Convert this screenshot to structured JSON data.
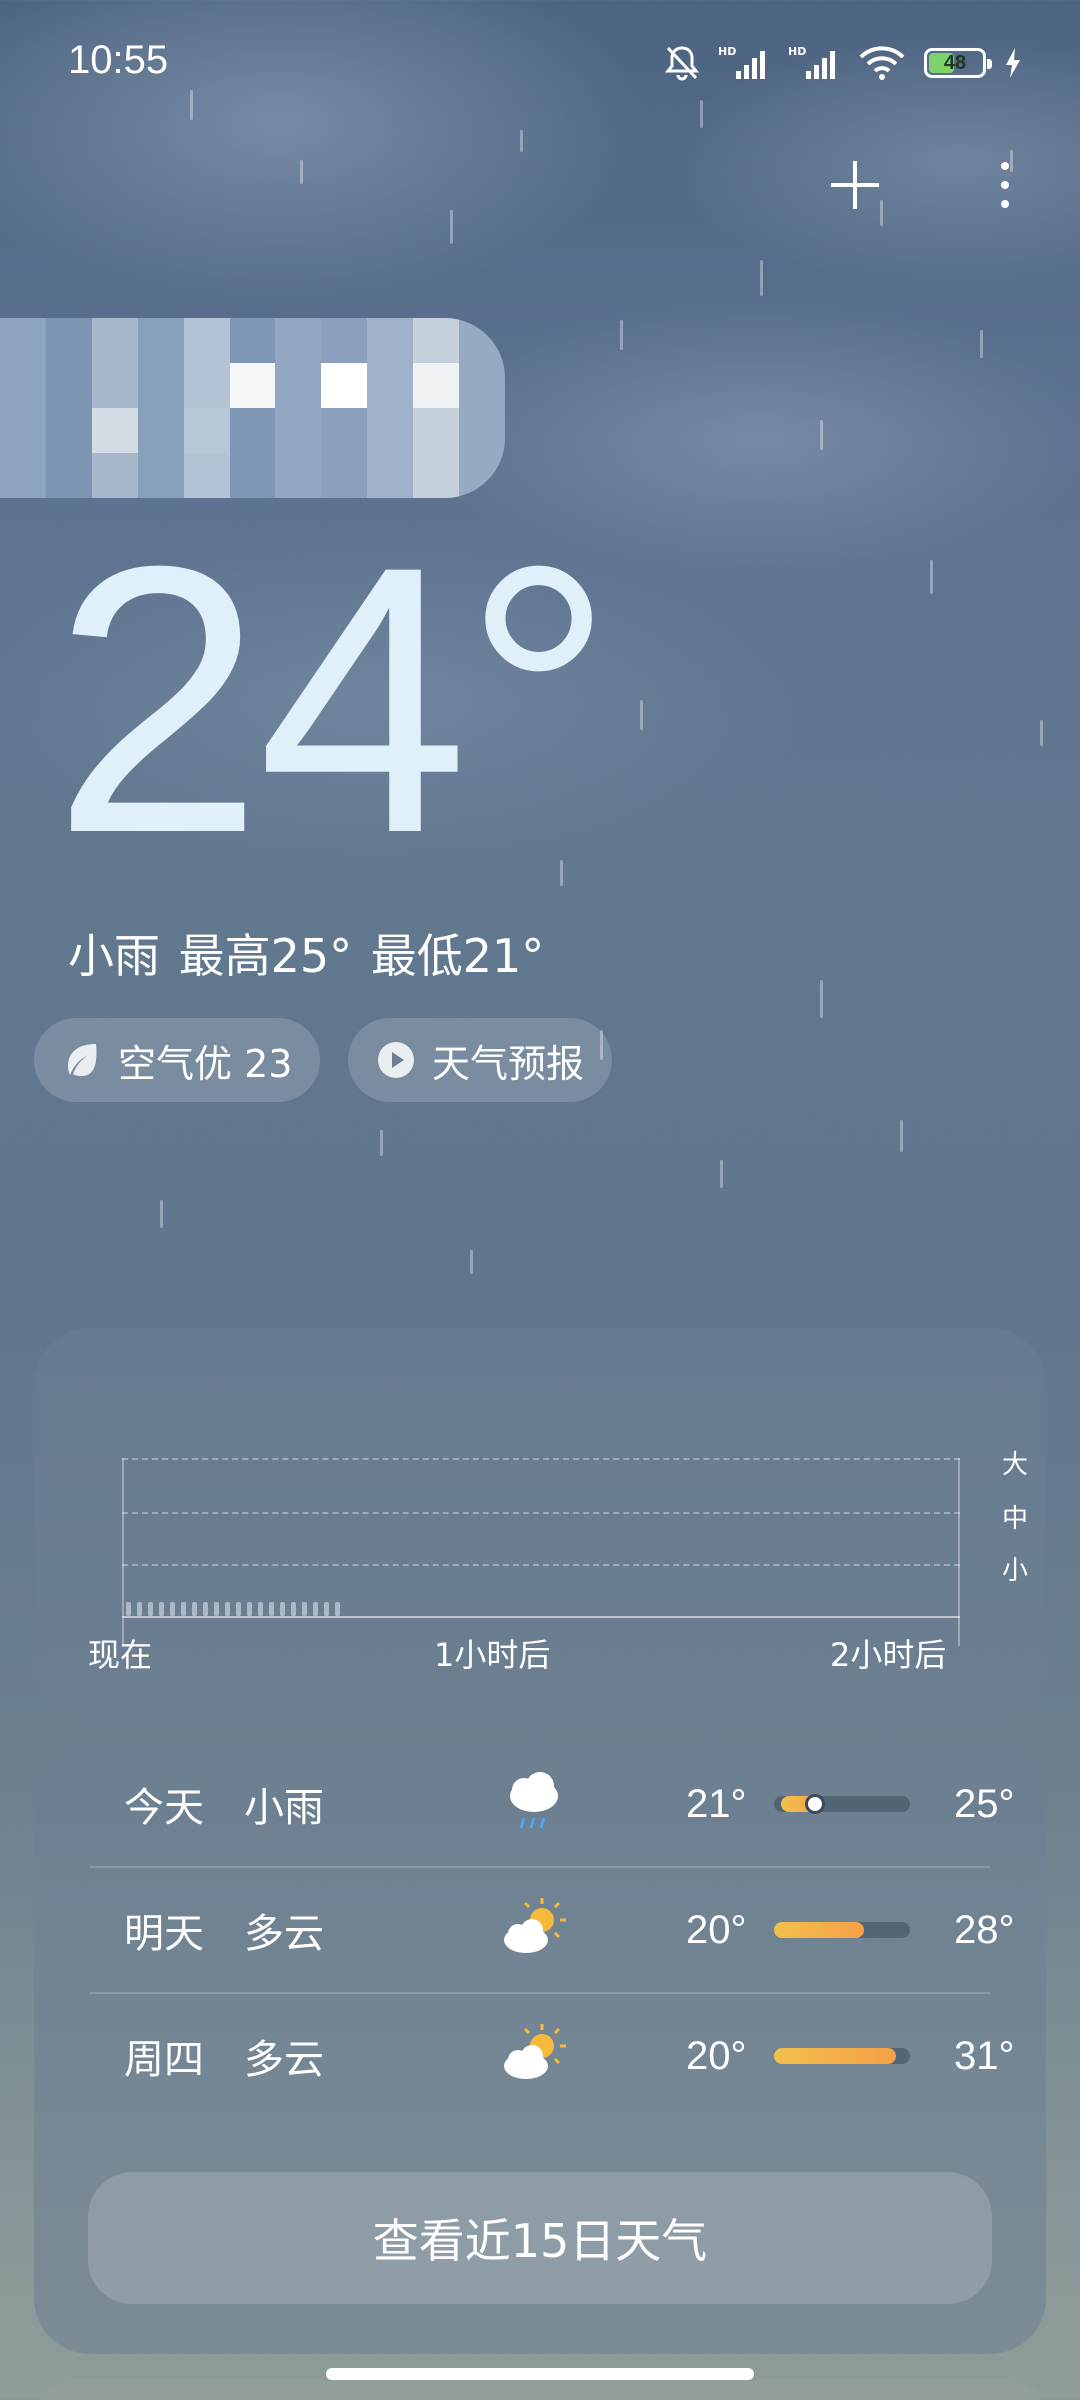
{
  "status_bar": {
    "time": "10:55",
    "battery": "48"
  },
  "current": {
    "temperature": "24°",
    "summary": "小雨  最高25° 最低21°"
  },
  "pills": [
    {
      "label": "空气优 23",
      "icon": "leaf-icon"
    },
    {
      "label": "天气预报",
      "icon": "play-icon"
    }
  ],
  "precipitation": {
    "levels": [
      "大",
      "中",
      "小"
    ],
    "time_labels": [
      "现在",
      "1小时后",
      "2小时后"
    ]
  },
  "forecast": [
    {
      "day": "今天",
      "condition": "小雨",
      "icon": "rain-cloud-icon",
      "low": "21°",
      "high": "25°",
      "range_start": 0.05,
      "range_end": 0.35,
      "current_marker": 0.3
    },
    {
      "day": "明天",
      "condition": "多云",
      "icon": "partly-cloudy-icon",
      "low": "20°",
      "high": "28°",
      "range_start": 0.0,
      "range_end": 0.66
    },
    {
      "day": "周四",
      "condition": "多云",
      "icon": "partly-cloudy-icon",
      "low": "20°",
      "high": "31°",
      "range_start": 0.0,
      "range_end": 0.9
    }
  ],
  "view_15_days": "查看近15日天气",
  "colors": {
    "temp_text": "#dff0fb",
    "bar_warm": "#f4c04b",
    "battery_fill": "#7ed36a"
  }
}
